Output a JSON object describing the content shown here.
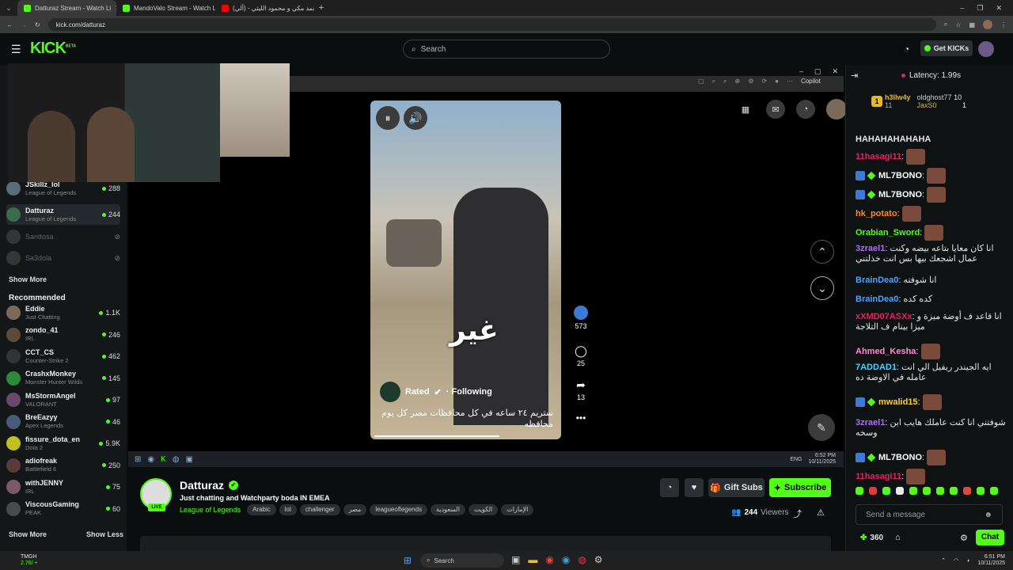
{
  "browser": {
    "tabs": [
      {
        "title": "Datturaz Stream - Watch Li",
        "active": true,
        "color": "#53fc18"
      },
      {
        "title": "MandoValo Stream - Watch Li",
        "active": false,
        "color": "#53fc18"
      },
      {
        "title": "أحمد مكي و محمود الليثي - (آلي)",
        "active": false,
        "color": "#ff0000"
      }
    ],
    "url": "kick.com/datturaz"
  },
  "header": {
    "logo": "KICK",
    "logo_beta": "BETA",
    "search_placeholder": "Search",
    "get_kicks": "Get KICKs"
  },
  "sidebar": {
    "following": [
      {
        "name": "JSkillz_lol",
        "game": "League of Legends",
        "viewers": "288",
        "live": true
      },
      {
        "name": "Datturaz",
        "game": "League of Legends",
        "viewers": "244",
        "live": true,
        "selected": true
      },
      {
        "name": "Santtosa",
        "game": "",
        "viewers": "",
        "live": false
      },
      {
        "name": "Sa3dola",
        "game": "",
        "viewers": "",
        "live": false
      }
    ],
    "show_more": "Show More",
    "recommended_title": "Recommended",
    "recommended": [
      {
        "name": "Eddie",
        "game": "Just Chatting",
        "viewers": "1.1K"
      },
      {
        "name": "zondo_41",
        "game": "IRL",
        "viewers": "246"
      },
      {
        "name": "CCT_CS",
        "game": "Counter-Strike 2",
        "viewers": "462"
      },
      {
        "name": "CrashxMonkey",
        "game": "Monster Hunter Wilds",
        "viewers": "145"
      },
      {
        "name": "MsStormAngel",
        "game": "VALORANT",
        "viewers": "97"
      },
      {
        "name": "BreEazyy",
        "game": "Apex Legends",
        "viewers": "46"
      },
      {
        "name": "fissure_dota_en",
        "game": "Dota 2",
        "viewers": "5.9K"
      },
      {
        "name": "adiofreak",
        "game": "Battlefield 6",
        "viewers": "250"
      },
      {
        "name": "withJENNY",
        "game": "IRL",
        "viewers": "75"
      },
      {
        "name": "ViscousGaming",
        "game": "PEAK",
        "viewers": "60"
      }
    ],
    "show_more_bottom": "Show More",
    "show_less": "Show Less"
  },
  "video": {
    "inner_copilot": "Copilot",
    "reel": {
      "caption_big": "غير",
      "likes": "573",
      "comments": "25",
      "shares": "13",
      "author": "Rated",
      "following": "· Following",
      "description": "ستريم ٢٤ ساعه في كل محافظات مصر كل يوم محافظه"
    },
    "windows_time": "6:52 PM",
    "windows_date": "10/11/2025",
    "lang": "ENG"
  },
  "channel": {
    "name": "Datturaz",
    "live": "LIVE",
    "title": "Just chatting and  Watchparty boda IN EMEA",
    "category": "League of Legends",
    "tags": [
      "Arabic",
      "lol",
      "challenger",
      "مصر",
      "leagueoflegends",
      "السعودية",
      "الكويت",
      "الإمارات"
    ],
    "gift_subs": "Gift Subs",
    "subscribe": "Subscribe",
    "viewers": "244",
    "viewers_label": "Viewers"
  },
  "chat": {
    "latency": "Latency: 1.99s",
    "leaderboard": [
      {
        "rank": "1",
        "name": "h3llw4y",
        "count": "11"
      },
      {
        "name": "oldghost77",
        "count": "10"
      },
      {
        "name": "JaxS0",
        "count": "1"
      }
    ],
    "messages": [
      {
        "user": "",
        "text": "HAHAHAHAHAHA",
        "color": "#ffffff"
      },
      {
        "user": "11hasagi11",
        "text": "",
        "color": "#e0245e",
        "emote": true
      },
      {
        "user": "ML7BONO",
        "text": "",
        "color": "#ffffff",
        "emote": true,
        "badges": true
      },
      {
        "user": "ML7BONO",
        "text": "",
        "color": "#ffffff",
        "emote": true,
        "badges": true
      },
      {
        "user": "hk_potato",
        "text": "",
        "color": "#ff8a1e",
        "emote": true
      },
      {
        "user": "Orabian_Sword",
        "text": "",
        "color": "#53fc18",
        "emote": true
      },
      {
        "user": "3zrael1",
        "text": "انا كان معايا بتاعه بيضه وكنت عمال اشجعك بيها بس انت خذلتني",
        "color": "#b06cff"
      },
      {
        "user": "BrainDea0",
        "text": "انا شوفته",
        "color": "#4aa3ff"
      },
      {
        "user": "BrainDea0",
        "text": "كده كده",
        "color": "#4aa3ff"
      },
      {
        "user": "xXMD07ASXx",
        "text": "انا قاعد ف أوضة ميزة و ميزا بينام ف التلاجة",
        "color": "#e0245e"
      },
      {
        "user": "Ahmed_Kesha",
        "text": "",
        "color": "#ff8ad8",
        "emote": true
      },
      {
        "user": "7ADDAD1",
        "text": "ايه الجيندر ريفيل الي انت عامله في الاوضة ده",
        "color": "#4ad0ff"
      },
      {
        "user": "mwalid15",
        "text": "",
        "color": "#ffd21e",
        "emote": true,
        "badges": true
      },
      {
        "user": "3zrael1",
        "text": "شوفتني انا كنت عاملك هايب ابن وسخه",
        "color": "#b06cff"
      },
      {
        "user": "ML7BONO",
        "text": "",
        "color": "#ffffff",
        "emote": true,
        "badges": true
      },
      {
        "user": "11hasagi11",
        "text": "",
        "color": "#e0245e",
        "emote": true
      }
    ],
    "input_placeholder": "Send a message",
    "kicks": "360",
    "chat_button": "Chat"
  },
  "taskbar": {
    "left_label": "TMGH",
    "left_sub": "2.76/ +",
    "search": "Search",
    "time": "6:51 PM",
    "date": "10/11/2025"
  }
}
